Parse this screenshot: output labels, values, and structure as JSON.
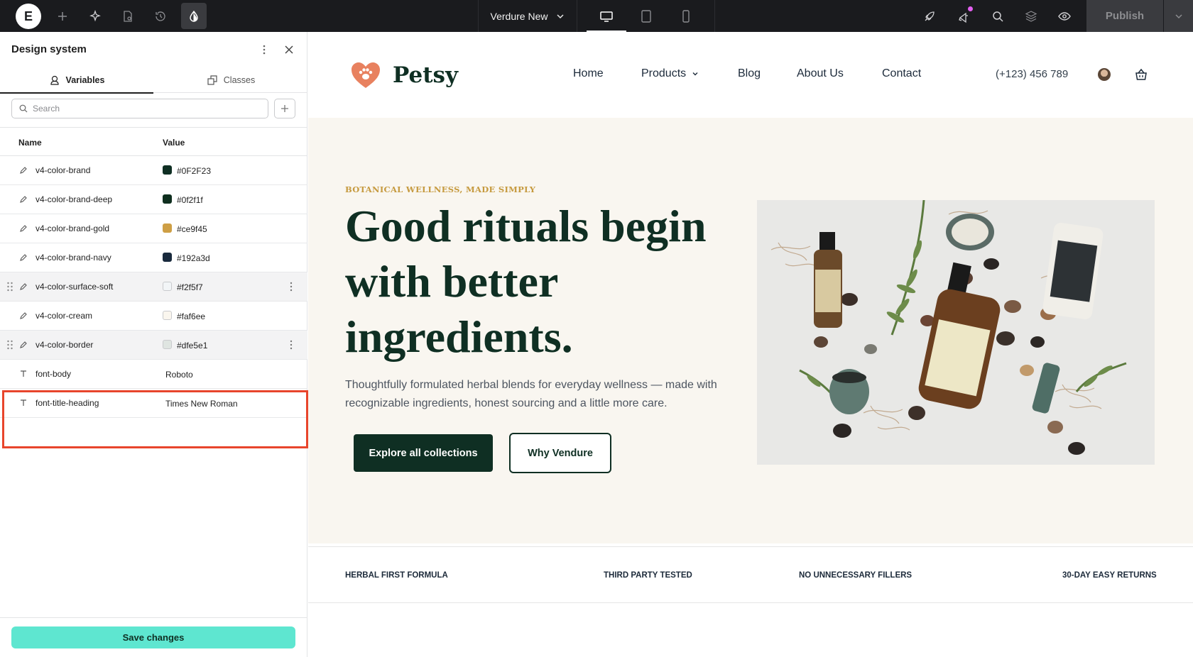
{
  "topbar": {
    "site_name": "Verdure New",
    "publish_label": "Publish",
    "icons": [
      "elementor-logo-icon",
      "add-icon",
      "ai-sparkle-icon",
      "page-settings-icon",
      "history-icon",
      "design-system-icon",
      "desktop-icon",
      "tablet-icon",
      "mobile-icon",
      "launch-icon",
      "whats-new-icon",
      "search-icon",
      "structure-icon",
      "preview-icon",
      "chevron-down-icon"
    ]
  },
  "panel": {
    "title": "Design system",
    "tabs": [
      {
        "label": "Variables",
        "active": true
      },
      {
        "label": "Classes",
        "active": false
      }
    ],
    "search_placeholder": "Search",
    "columns": {
      "name": "Name",
      "value": "Value"
    },
    "variables": [
      {
        "name": "v4-color-brand",
        "value": "#0F2F23",
        "type": "color",
        "swatch": "#0F2F23"
      },
      {
        "name": "v4-color-brand-deep",
        "value": "#0f2f1f",
        "type": "color",
        "swatch": "#0f2f1f"
      },
      {
        "name": "v4-color-brand-gold",
        "value": "#ce9f45",
        "type": "color",
        "swatch": "#ce9f45"
      },
      {
        "name": "v4-color-brand-navy",
        "value": "#192a3d",
        "type": "color",
        "swatch": "#192a3d"
      },
      {
        "name": "v4-color-surface-soft",
        "value": "#f2f5f7",
        "type": "color",
        "swatch": "#f2f5f7"
      },
      {
        "name": "v4-color-cream",
        "value": "#faf6ee",
        "type": "color",
        "swatch": "#faf6ee"
      },
      {
        "name": "v4-color-border",
        "value": "#dfe5e1",
        "type": "color",
        "swatch": "#dfe5e1"
      },
      {
        "name": "font-body",
        "value": "Roboto",
        "type": "font"
      },
      {
        "name": "font-title-heading",
        "value": "Times New Roman",
        "type": "font"
      }
    ],
    "save_label": "Save changes",
    "save_color": "#5ee6d0",
    "highlight_color": "#e8452c"
  },
  "site": {
    "brand": "Petsy",
    "nav": [
      {
        "label": "Home"
      },
      {
        "label": "Products"
      },
      {
        "label": "Blog"
      },
      {
        "label": "About Us"
      },
      {
        "label": "Contact"
      }
    ],
    "phone": "(+123) 456 789",
    "hero": {
      "eyebrow": "BOTANICAL WELLNESS, MADE SIMPLY",
      "title": "Good rituals begin with better ingredients.",
      "subtitle": "Thoughtfully formulated herbal blends for everyday wellness — made with recognizable ingredients, honest sourcing and a little more care.",
      "primary_cta": "Explore all collections",
      "secondary_cta": "Why Vendure"
    },
    "features": [
      "HERBAL FIRST FORMULA",
      "THIRD PARTY TESTED",
      "NO UNNECESSARY FILLERS",
      "30-DAY EASY RETURNS"
    ],
    "colors": {
      "brand": "#0F2F23",
      "gold": "#c69a3f",
      "cream": "#f9f6f0"
    }
  }
}
